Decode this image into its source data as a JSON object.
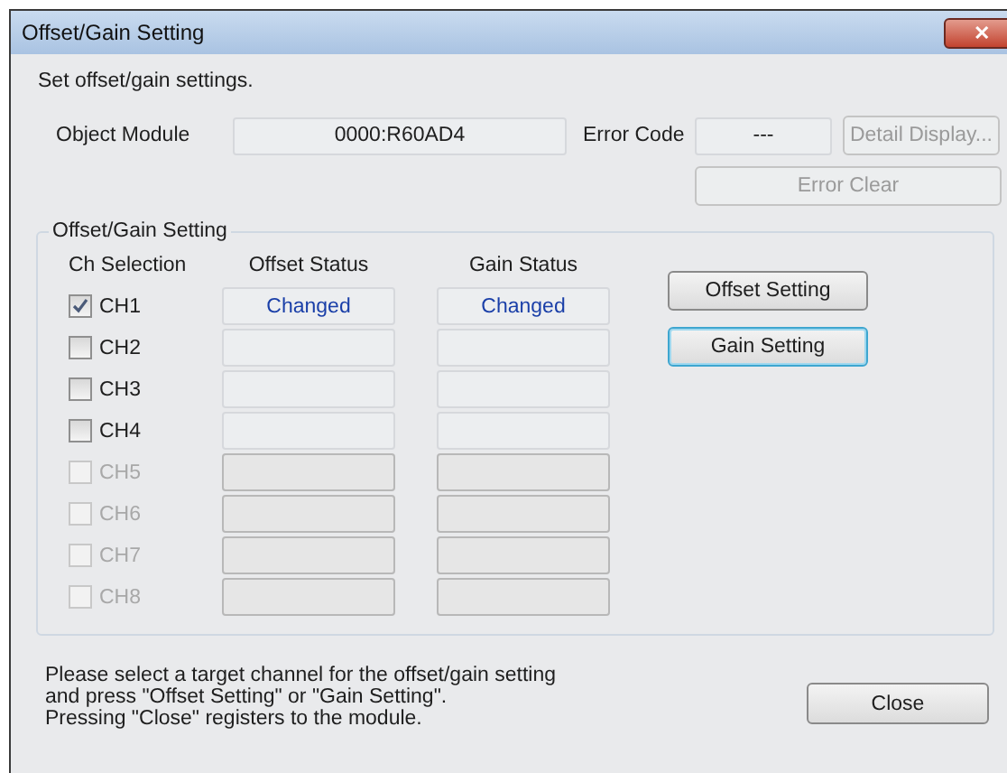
{
  "window": {
    "title": "Offset/Gain Setting",
    "close_glyph": "✕"
  },
  "intro": "Set offset/gain settings.",
  "object_module": {
    "label": "Object Module",
    "value": "0000:R60AD4"
  },
  "error_code": {
    "label": "Error Code",
    "value": "---"
  },
  "detail_button": {
    "label": "Detail Display...",
    "disabled": true
  },
  "error_clear_button": {
    "label": "Error Clear",
    "disabled": true
  },
  "group": {
    "title": "Offset/Gain Setting",
    "headers": [
      "Ch Selection",
      "Offset Status",
      "Gain Status"
    ],
    "channels": [
      {
        "label": "CH1",
        "checked": true,
        "disabled": false,
        "offset_status": "Changed",
        "gain_status": "Changed"
      },
      {
        "label": "CH2",
        "checked": false,
        "disabled": false
      },
      {
        "label": "CH3",
        "checked": false,
        "disabled": false
      },
      {
        "label": "CH4",
        "checked": false,
        "disabled": false
      },
      {
        "label": "CH5",
        "checked": false,
        "disabled": true
      },
      {
        "label": "CH6",
        "checked": false,
        "disabled": true
      },
      {
        "label": "CH7",
        "checked": false,
        "disabled": true
      },
      {
        "label": "CH8",
        "checked": false,
        "disabled": true
      }
    ],
    "buttons": [
      {
        "label": "Offset Setting",
        "focused": false
      },
      {
        "label": "Gain Setting",
        "focused": true
      }
    ]
  },
  "footer": {
    "lines": [
      "Please select a target channel for the offset/gain setting",
      "and press \"Offset Setting\" or \"Gain Setting\".",
      "Pressing \"Close\" registers to the module."
    ],
    "close_button": "Close"
  }
}
